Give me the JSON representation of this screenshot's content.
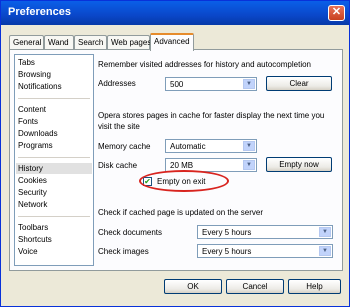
{
  "window": {
    "title": "Preferences",
    "close_icon": "close-icon"
  },
  "tabs": [
    "General",
    "Wand",
    "Search",
    "Web pages",
    "Advanced"
  ],
  "sidebar": {
    "group1": [
      "Tabs",
      "Browsing",
      "Notifications"
    ],
    "group2": [
      "Content",
      "Fonts",
      "Downloads",
      "Programs"
    ],
    "group3": [
      "History",
      "Cookies",
      "Security",
      "Network"
    ],
    "group4": [
      "Toolbars",
      "Shortcuts",
      "Voice"
    ]
  },
  "history": {
    "remember_text": "Remember visited addresses for history and autocompletion",
    "addresses_label": "Addresses",
    "addresses_value": "500",
    "clear_button": "Clear",
    "cache_text": "Opera stores pages in cache for faster display the next time you visit the site",
    "memory_cache_label": "Memory cache",
    "memory_cache_value": "Automatic",
    "disk_cache_label": "Disk cache",
    "disk_cache_value": "20 MB",
    "empty_now_button": "Empty now",
    "empty_on_exit_label": "Empty on exit",
    "empty_on_exit_checked": true,
    "check_updated_text": "Check if cached page is updated on the server",
    "check_documents_label": "Check documents",
    "check_documents_value": "Every 5 hours",
    "check_images_label": "Check images",
    "check_images_value": "Every 5 hours"
  },
  "footer": {
    "ok": "OK",
    "cancel": "Cancel",
    "help": "Help"
  },
  "colors": {
    "highlight": "#d8241f",
    "accent": "#0a5fe8"
  }
}
